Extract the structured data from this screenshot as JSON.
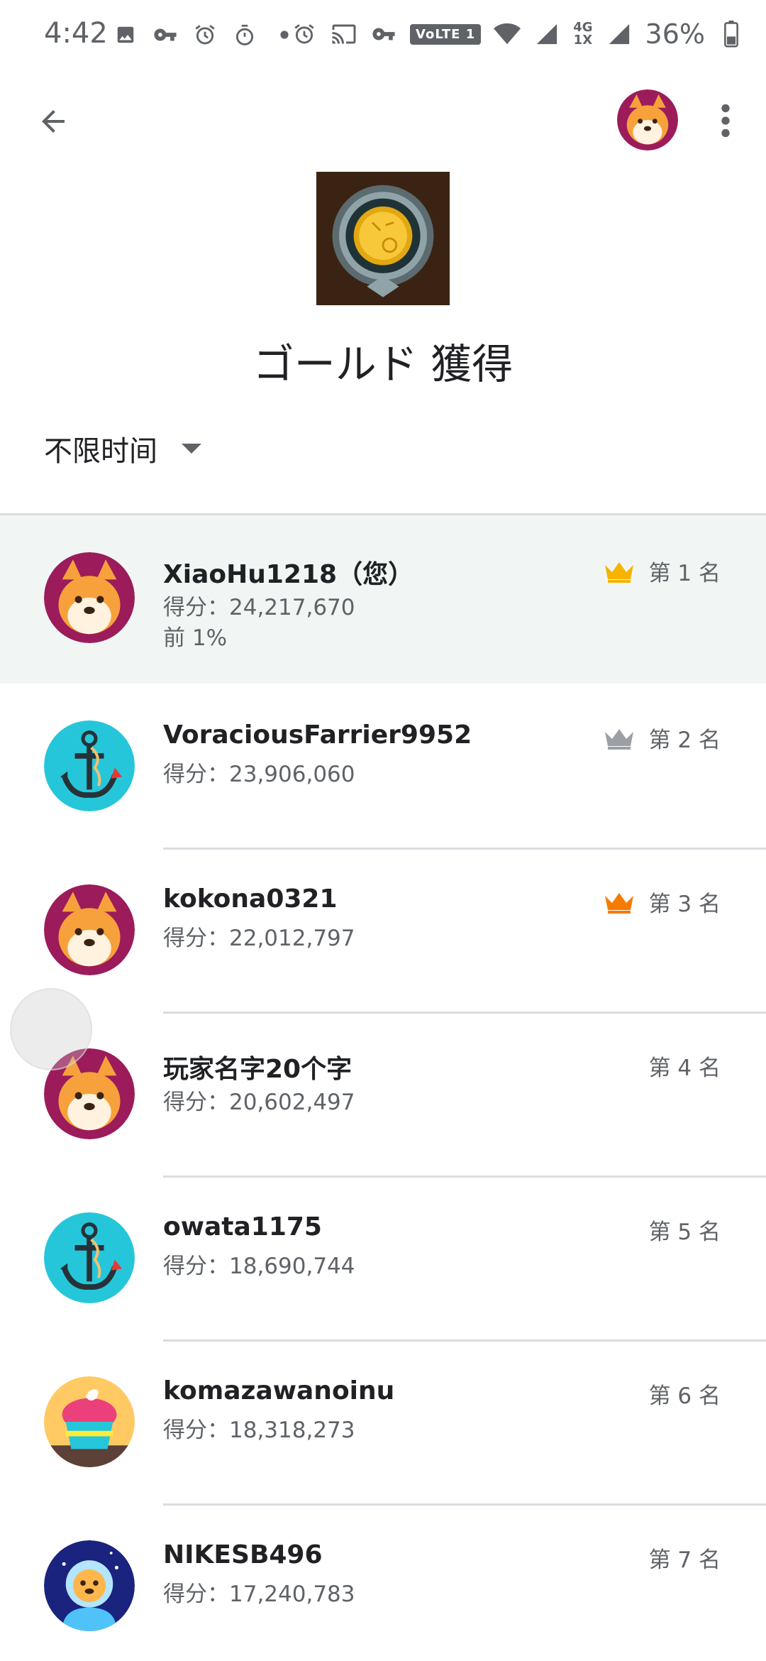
{
  "status_bar": {
    "time": "4:42",
    "left_icons": [
      "image-icon",
      "key-icon",
      "alarm-icon",
      "timer-icon",
      "dot-icon"
    ],
    "right_icons": [
      "alarm-icon",
      "cast-icon",
      "key-icon",
      "volte-icon",
      "wifi-icon",
      "signal-icon",
      "signal-icon"
    ],
    "volte_label": "VoLTE 1",
    "network_top": "4G",
    "network_bottom": "1X",
    "battery": "36%"
  },
  "header": {
    "back_icon": "arrow-back-icon",
    "avatar": "shiba-avatar",
    "menu_icon": "more-vert-icon"
  },
  "achievement": {
    "title": "ゴールド 獲得",
    "image": "gold-medal-icon"
  },
  "filter": {
    "label": "不限时间"
  },
  "leaderboard": [
    {
      "name": "XiaoHu1218（您）",
      "score": "得分：24,217,670",
      "percent": "前 1%",
      "rank": "第 1 名",
      "crown": "gold",
      "avatar": "shiba",
      "highlight": true
    },
    {
      "name": "VoraciousFarrier9952",
      "score": "得分：23,906,060",
      "rank": "第 2 名",
      "crown": "silver",
      "avatar": "anchor"
    },
    {
      "name": "kokona0321",
      "score": "得分：22,012,797",
      "rank": "第 3 名",
      "crown": "bronze",
      "avatar": "shiba"
    },
    {
      "name": "玩家名字20个字",
      "score": "得分：20,602,497",
      "rank": "第 4 名",
      "avatar": "shiba"
    },
    {
      "name": "owata1175",
      "score": "得分：18,690,744",
      "rank": "第 5 名",
      "avatar": "anchor"
    },
    {
      "name": "komazawanoinu",
      "score": "得分：18,318,273",
      "rank": "第 6 名",
      "avatar": "cupcake"
    },
    {
      "name": "NIKESB496",
      "score": "得分：17,240,783",
      "rank": "第 7 名",
      "avatar": "astronaut"
    }
  ],
  "colors": {
    "highlight_bg": "#f1f6f4",
    "crown_gold": "#f4b400",
    "crown_silver": "#9aa0a6",
    "crown_bronze": "#f57c00",
    "shiba_bg": "#9c1b5b",
    "anchor_bg": "#26c6da",
    "cupcake_bg": "#ffca64",
    "astronaut_bg": "#1a237e"
  }
}
